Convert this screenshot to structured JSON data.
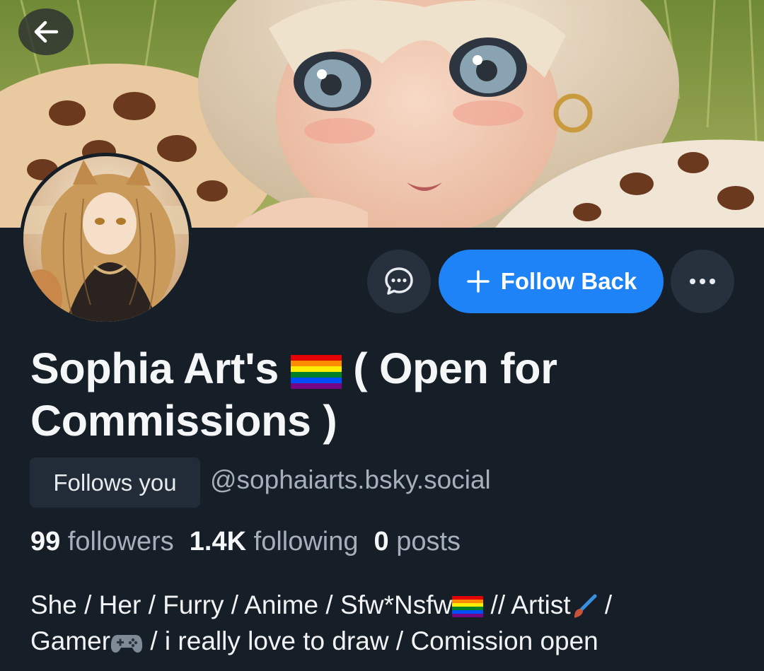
{
  "header": {
    "back_icon": "arrow-left-icon"
  },
  "profile": {
    "display_name_part1": "Sophia Art's",
    "display_name_part2": "( Open for",
    "display_name_part3": "Commissions )",
    "follows_you_label": "Follows you",
    "handle": "@sophaiarts.bsky.social"
  },
  "actions": {
    "message_icon": "chat-bubble-icon",
    "follow_label": "Follow Back",
    "follow_icon": "plus-icon",
    "more_icon": "ellipsis-icon"
  },
  "stats": {
    "followers_count": "99",
    "followers_label": "followers",
    "following_count": "1.4K",
    "following_label": "following",
    "posts_count": "0",
    "posts_label": "posts"
  },
  "bio": {
    "line1_a": "She / Her / Furry / Anime / Sfw*Nsfw",
    "line1_b": " // Artist",
    "line1_c": " /",
    "line2_a": "Gamer",
    "line2_b": "  / i really love to draw / Comission open"
  },
  "colors": {
    "background": "#161e27",
    "accent_blue": "#1e83f7",
    "button_gray": "#27313d",
    "muted_text": "#a5b0bc"
  }
}
